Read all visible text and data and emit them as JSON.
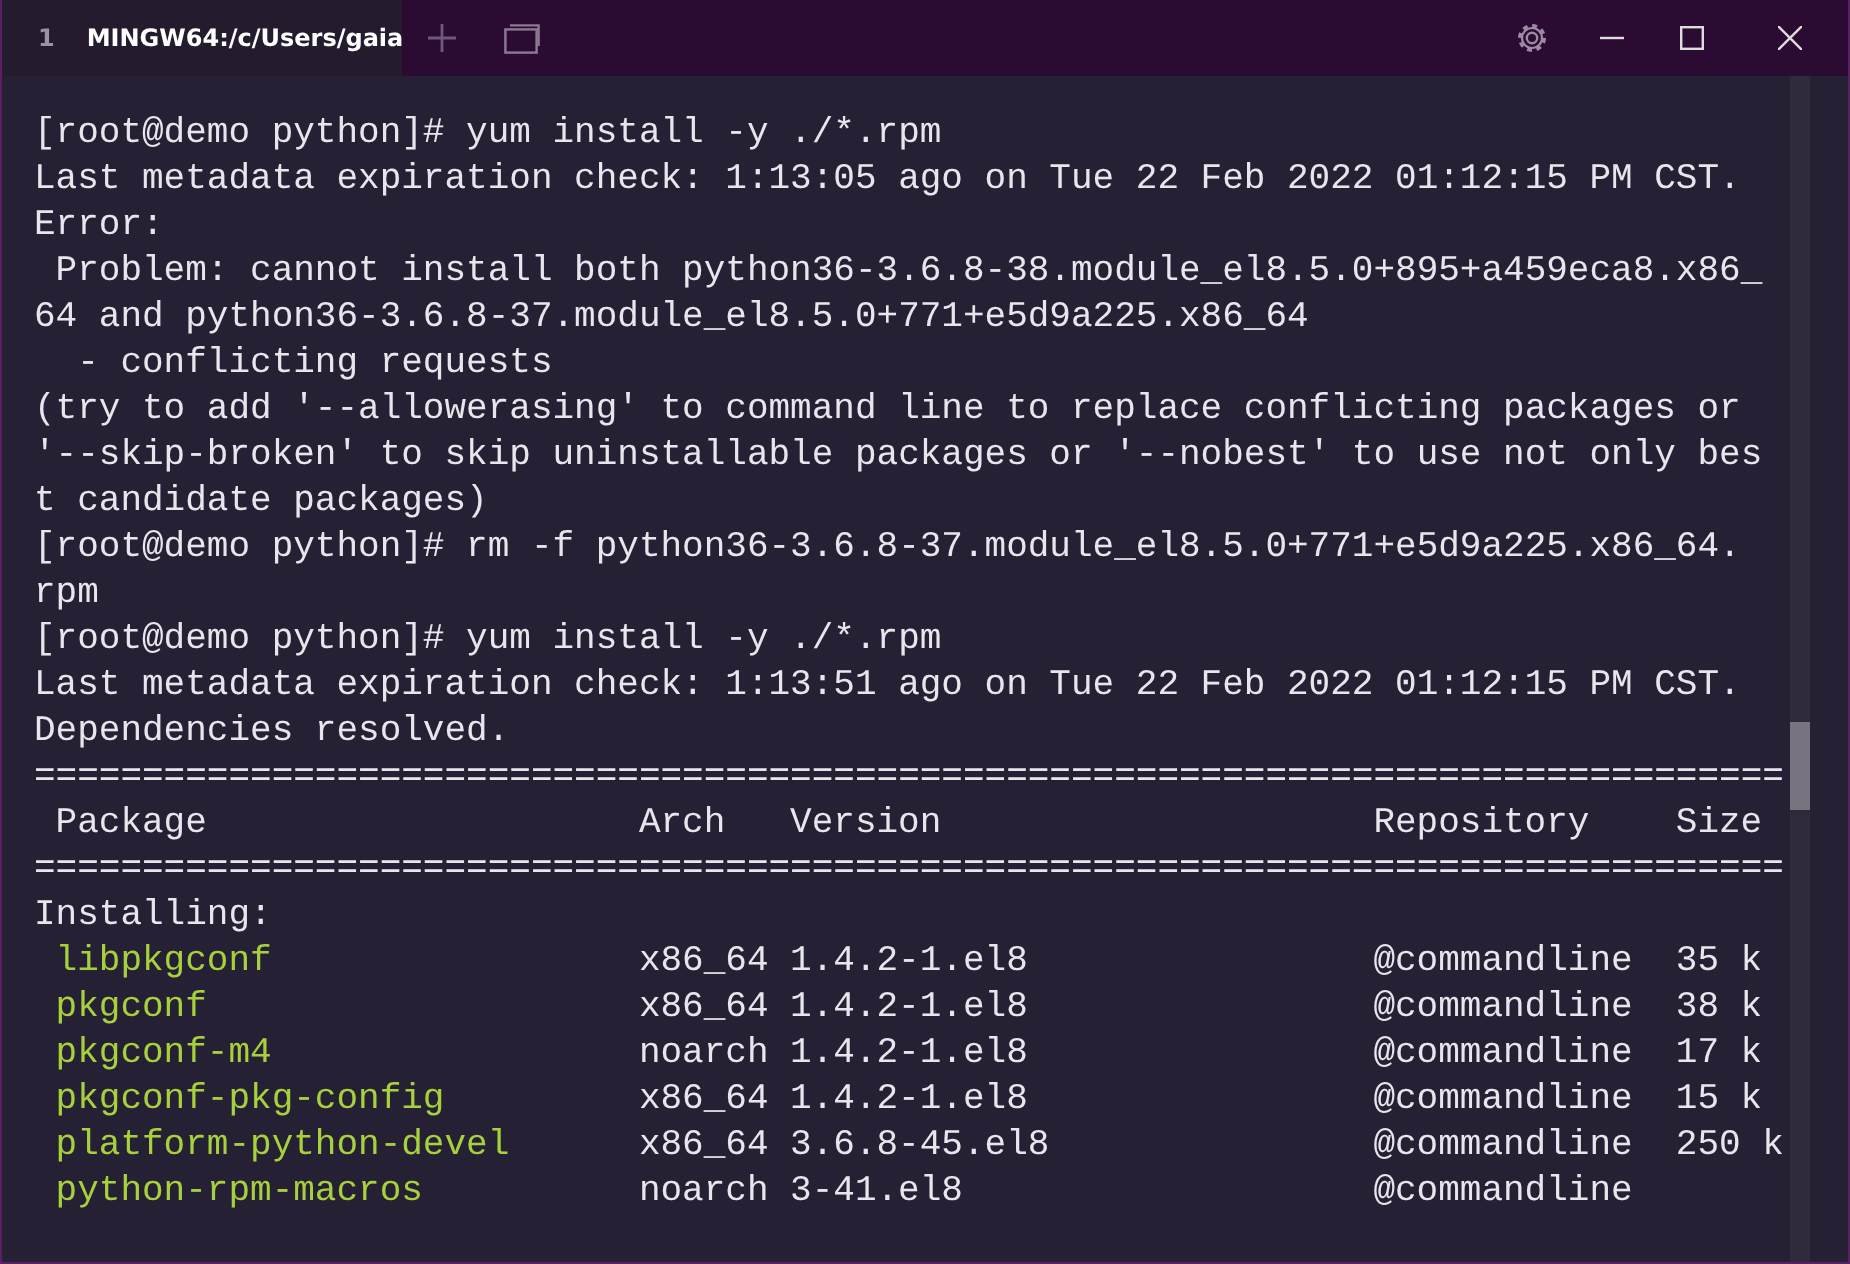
{
  "window": {
    "tab": {
      "number": "1",
      "title": "MINGW64:/c/Users/gaia",
      "selected": true
    }
  },
  "terminal": {
    "lines": [
      {
        "kind": "text",
        "text": "[root@demo python]# yum install -y ./*.rpm"
      },
      {
        "kind": "text",
        "text": "Last metadata expiration check: 1:13:05 ago on Tue 22 Feb 2022 01:12:15 PM CST."
      },
      {
        "kind": "text",
        "text": "Error:"
      },
      {
        "kind": "text",
        "text": " Problem: cannot install both python36-3.6.8-38.module_el8.5.0+895+a459eca8.x86_"
      },
      {
        "kind": "text",
        "text": "64 and python36-3.6.8-37.module_el8.5.0+771+e5d9a225.x86_64"
      },
      {
        "kind": "text",
        "text": "  - conflicting requests"
      },
      {
        "kind": "text",
        "text": "(try to add '--allowerasing' to command line to replace conflicting packages or"
      },
      {
        "kind": "text",
        "text": "'--skip-broken' to skip uninstallable packages or '--nobest' to use not only bes"
      },
      {
        "kind": "text",
        "text": "t candidate packages)"
      },
      {
        "kind": "text",
        "text": "[root@demo python]# rm -f python36-3.6.8-37.module_el8.5.0+771+e5d9a225.x86_64."
      },
      {
        "kind": "text",
        "text": "rpm"
      },
      {
        "kind": "text",
        "text": "[root@demo python]# yum install -y ./*.rpm"
      },
      {
        "kind": "text",
        "text": "Last metadata expiration check: 1:13:51 ago on Tue 22 Feb 2022 01:12:15 PM CST."
      },
      {
        "kind": "text",
        "text": "Dependencies resolved."
      },
      {
        "kind": "rule",
        "text": "================================================================================="
      },
      {
        "kind": "header",
        "cells": [
          "Package",
          "Arch",
          "Version",
          "Repository",
          "Size"
        ]
      },
      {
        "kind": "rule",
        "text": "================================================================================="
      },
      {
        "kind": "text",
        "text": "Installing:"
      },
      {
        "kind": "package",
        "name": "libpkgconf",
        "arch": "x86_64",
        "version": "1.4.2-1.el8",
        "repository": "@commandline",
        "size": "35 k"
      },
      {
        "kind": "package",
        "name": "pkgconf",
        "arch": "x86_64",
        "version": "1.4.2-1.el8",
        "repository": "@commandline",
        "size": "38 k"
      },
      {
        "kind": "package",
        "name": "pkgconf-m4",
        "arch": "noarch",
        "version": "1.4.2-1.el8",
        "repository": "@commandline",
        "size": "17 k"
      },
      {
        "kind": "package",
        "name": "pkgconf-pkg-config",
        "arch": "x86_64",
        "version": "1.4.2-1.el8",
        "repository": "@commandline",
        "size": "15 k"
      },
      {
        "kind": "package",
        "name": "platform-python-devel",
        "arch": "x86_64",
        "version": "3.6.8-45.el8",
        "repository": "@commandline",
        "size": "250 k"
      },
      {
        "kind": "package",
        "name": "python-rpm-macros",
        "arch": "noarch",
        "version": "3-41.el8",
        "repository": "@commandline"
      }
    ]
  }
}
